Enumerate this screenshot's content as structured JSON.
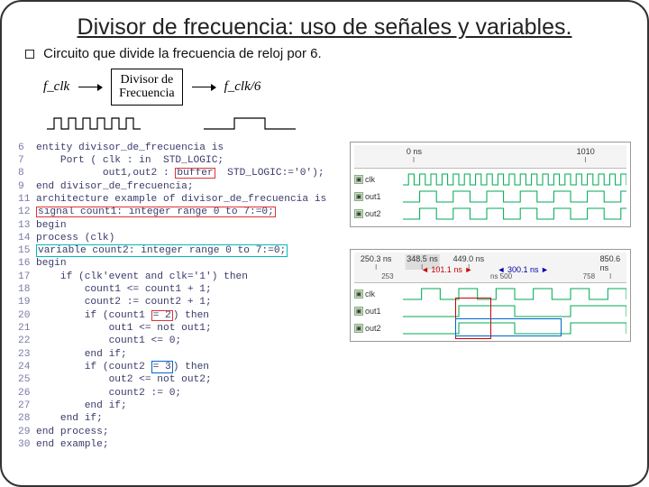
{
  "title": "Divisor de frecuencia: uso de señales y variables.",
  "subtitle": "Circuito que divide la frecuencia de reloj por 6.",
  "block": {
    "in_label": "f_clk",
    "box_l1": "Divisor de",
    "box_l2": "Frecuencia",
    "out_label": "f_clk/6"
  },
  "code": {
    "l6": "entity divisor_de_frecuencia is",
    "l7": "    Port ( clk : in  STD_LOGIC;",
    "l8a": "           out1,out2 : ",
    "l8b": "buffer",
    "l8c": "  STD_LOGIC:='0');",
    "l9": "end divisor_de_frecuencia;",
    "l11": "architecture example of divisor_de_frecuencia is",
    "l12": "signal count1: integer range 0 to 7:=0;",
    "l13": "begin",
    "l14": "process (clk)",
    "l15": "variable count2: integer range 0 to 7:=0;",
    "l16": "begin",
    "l17": "    if (clk'event and clk='1') then",
    "l18": "        count1 <= count1 + 1;",
    "l19": "        count2 := count2 + 1;",
    "l20a": "        if (count1 ",
    "l20b": "= 2",
    "l20c": ") then",
    "l21": "            out1 <= not out1;",
    "l22": "            count1 <= 0;",
    "l23": "        end if;",
    "l24a": "        if (count2 ",
    "l24b": "= 3",
    "l24c": ") then",
    "l25": "            out2 <= not out2;",
    "l26": "            count2 := 0;",
    "l27": "        end if;",
    "l28": "    end if;",
    "l29": "end process;",
    "l30": "end example;"
  },
  "sim1": {
    "ticks": [
      "0 ns",
      "1010"
    ],
    "rows": [
      "clk",
      "out1",
      "out2"
    ]
  },
  "sim2": {
    "ticks": [
      "250.3 ns",
      "348.5 ns",
      "449.0 ns",
      "850.6 ns"
    ],
    "marker_red": "101.1 ns",
    "marker_blue": "300.1 ns",
    "ruler2": [
      "253",
      "ns 500",
      "758"
    ],
    "rows": [
      "clk",
      "out1",
      "out2"
    ]
  }
}
